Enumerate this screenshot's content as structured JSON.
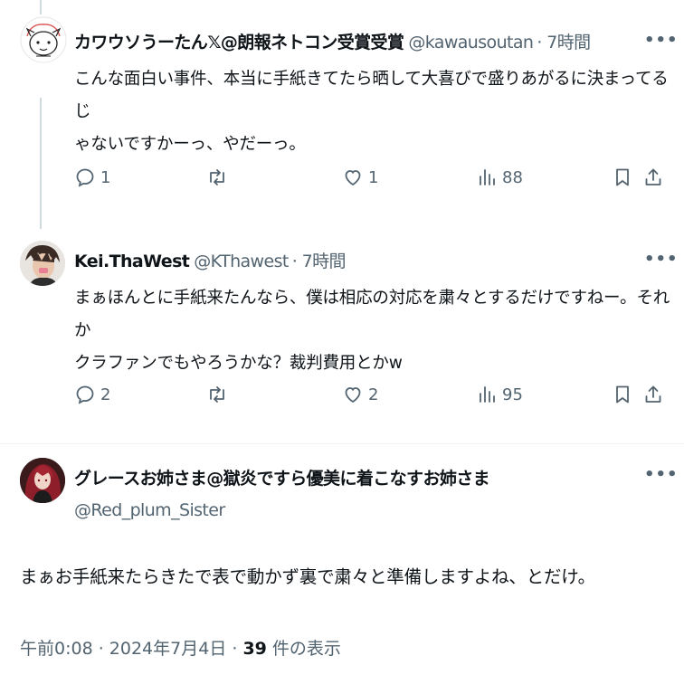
{
  "replies": [
    {
      "display_name": "カワウソうーたん𝕏@朗報ネトコン受賞受賞",
      "handle": "@kawausoutan",
      "time": "· 7時間",
      "text_lines": [
        "こんな面白い事件、本当に手紙きてたら晒して大喜びで盛りあがるに決まってるじ",
        "ゃないですかーっ、やだーっ。"
      ],
      "replies_count": "1",
      "retweets_count": "",
      "likes_count": "1",
      "views_count": "88",
      "avatar_icon": "otter-doodle-avatar"
    },
    {
      "display_name": "Kei.ThaWest",
      "handle": "@KThawest",
      "time": "· 7時間",
      "text_lines": [
        "まぁほんとに手紙来たんなら、僕は相応の対応を粛々とするだけですねー。それか",
        "クラファンでもやろうかな？裁判費用とかw"
      ],
      "replies_count": "2",
      "retweets_count": "",
      "likes_count": "2",
      "views_count": "95",
      "avatar_icon": "anime-character-avatar"
    }
  ],
  "main_post": {
    "display_name": "グレースお姉さま@獄炎ですら優美に着こなすお姉さま",
    "handle": "@Red_plum_Sister",
    "text": "まぁお手紙来たらきたで表で動かず裏で粛々と準備しますよね、とだけ。",
    "timestamp": "午前0:08 · 2024年7月4日 · ",
    "views_number": "39",
    "views_label": " 件の表示",
    "avatar_icon": "red-haired-character-avatar"
  },
  "colors": {
    "text": "#0f1419",
    "secondary": "#536471",
    "line": "#cfd9de"
  }
}
